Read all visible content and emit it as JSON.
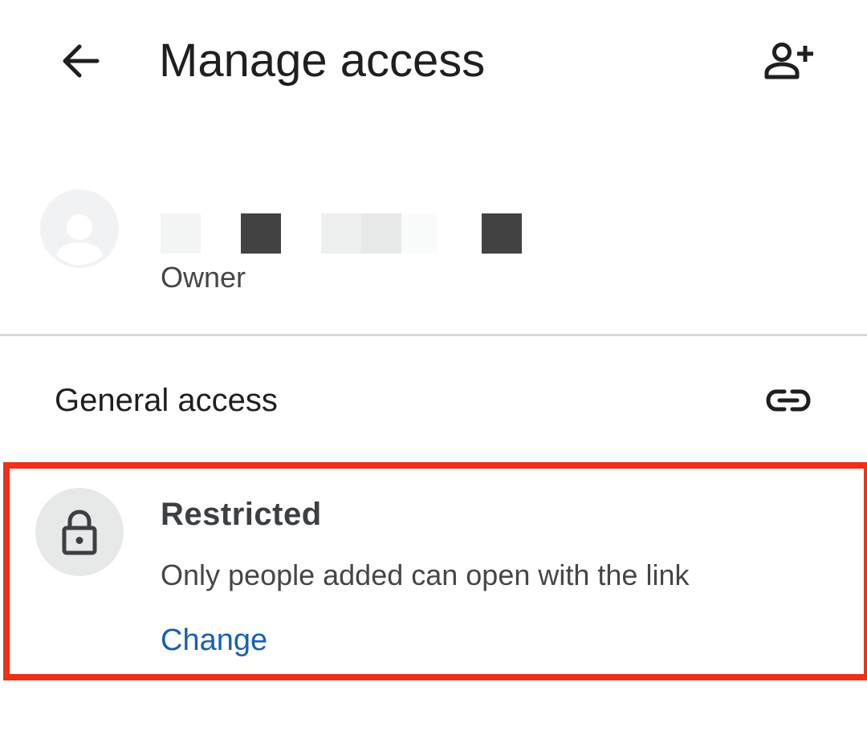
{
  "header": {
    "title": "Manage access",
    "back_icon": "arrow-back-icon",
    "add_person_icon": "person-add-icon"
  },
  "owner": {
    "name_redacted": true,
    "role": "Owner",
    "avatar_icon": "person-avatar-icon"
  },
  "general_access": {
    "title": "General access",
    "link_icon": "link-icon"
  },
  "access_level": {
    "icon": "lock-icon",
    "title": "Restricted",
    "description": "Only people added can open with the link",
    "change_label": "Change"
  },
  "colors": {
    "highlight": "#ee3017",
    "link": "#1a5fb4",
    "lock_bg": "#e6e9e7"
  }
}
